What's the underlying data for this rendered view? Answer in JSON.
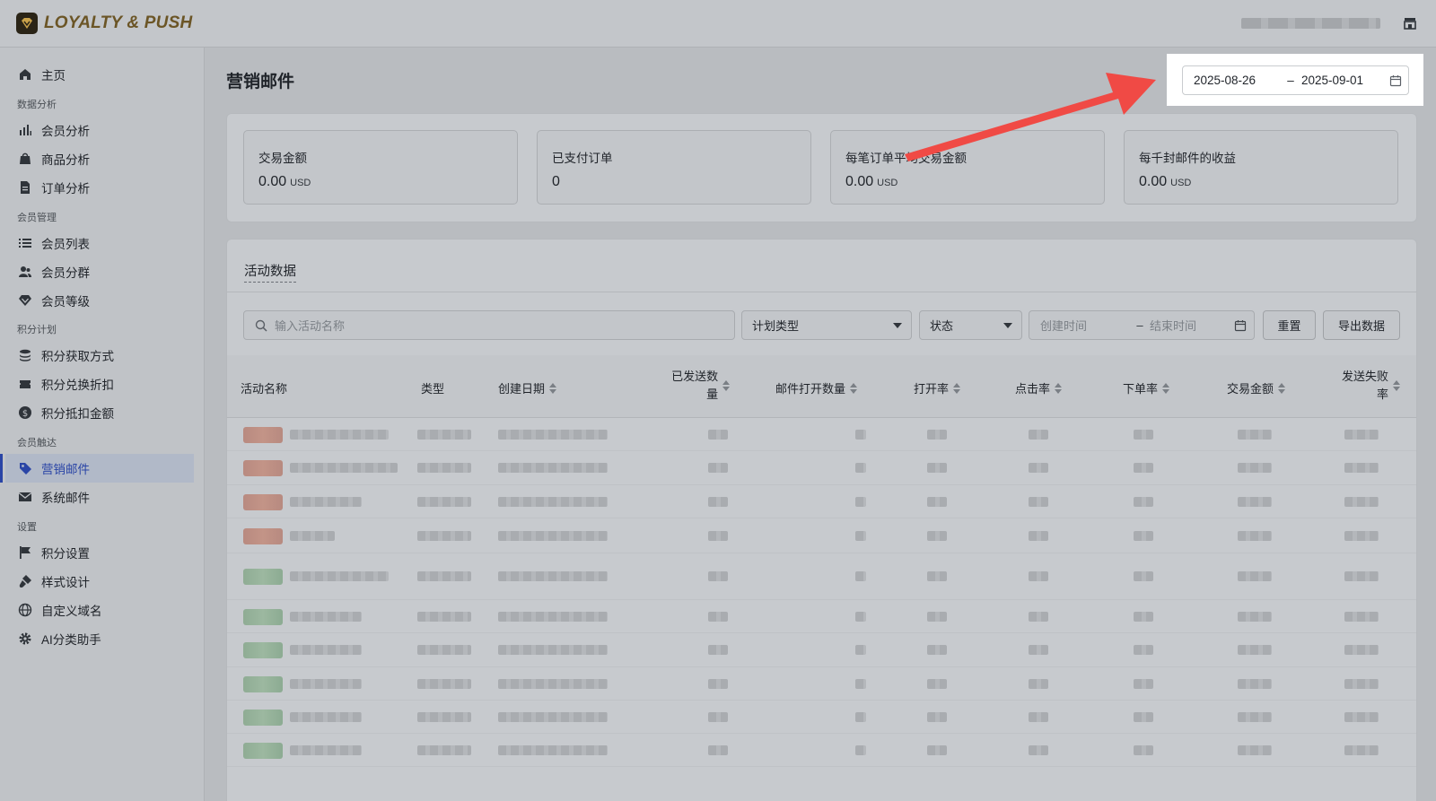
{
  "app": {
    "name": "LOYALTY & PUSH"
  },
  "sidebar": {
    "items": [
      {
        "label": "主页",
        "icon": "home-icon",
        "active": false
      },
      {
        "group": "数据分析"
      },
      {
        "label": "会员分析",
        "icon": "bar-chart-icon",
        "active": false
      },
      {
        "label": "商品分析",
        "icon": "shopping-bag-icon",
        "active": false
      },
      {
        "label": "订单分析",
        "icon": "document-icon",
        "active": false
      },
      {
        "group": "会员管理"
      },
      {
        "label": "会员列表",
        "icon": "list-icon",
        "active": false
      },
      {
        "label": "会员分群",
        "icon": "users-icon",
        "active": false
      },
      {
        "label": "会员等级",
        "icon": "diamond-icon",
        "active": false
      },
      {
        "group": "积分计划"
      },
      {
        "label": "积分获取方式",
        "icon": "coins-icon",
        "active": false
      },
      {
        "label": "积分兑换折扣",
        "icon": "ticket-icon",
        "active": false
      },
      {
        "label": "积分抵扣金额",
        "icon": "dollar-icon",
        "active": false
      },
      {
        "group": "会员触达"
      },
      {
        "label": "营销邮件",
        "icon": "tag-icon",
        "active": true
      },
      {
        "label": "系统邮件",
        "icon": "mail-icon",
        "active": false
      },
      {
        "group": "设置"
      },
      {
        "label": "积分设置",
        "icon": "flag-icon",
        "active": false
      },
      {
        "label": "样式设计",
        "icon": "brush-icon",
        "active": false
      },
      {
        "label": "自定义域名",
        "icon": "globe-icon",
        "active": false
      },
      {
        "label": "AI分类助手",
        "icon": "gear-icon",
        "active": false
      }
    ]
  },
  "header": {
    "title": "营销邮件",
    "date_range": {
      "start": "2025-08-26",
      "separator": "–",
      "end": "2025-09-01"
    }
  },
  "metrics": [
    {
      "label": "交易金额",
      "value": "0.00",
      "unit": "USD"
    },
    {
      "label": "已支付订单",
      "value": "0",
      "unit": ""
    },
    {
      "label": "每笔订单平均交易金额",
      "value": "0.00",
      "unit": "USD"
    },
    {
      "label": "每千封邮件的收益",
      "value": "0.00",
      "unit": "USD"
    }
  ],
  "activity": {
    "title": "活动数据",
    "search_placeholder": "输入活动名称",
    "plan_type": "计划类型",
    "status": "状态",
    "created_start_placeholder": "创建时间",
    "created_end_placeholder": "结束时间",
    "range_separator": "–",
    "reset_label": "重置",
    "export_label": "导出数据",
    "columns": [
      "活动名称",
      "类型",
      "创建日期",
      "已发送数量",
      "邮件打开数量",
      "打开率",
      "点击率",
      "下单率",
      "交易金额",
      "发送失败率"
    ],
    "rows": [
      "red",
      "red",
      "red",
      "red",
      "green",
      "green",
      "green",
      "green",
      "green",
      "green"
    ]
  },
  "colors": {
    "accent": "#2a45a6",
    "highlight_arrow": "#f04a45"
  }
}
